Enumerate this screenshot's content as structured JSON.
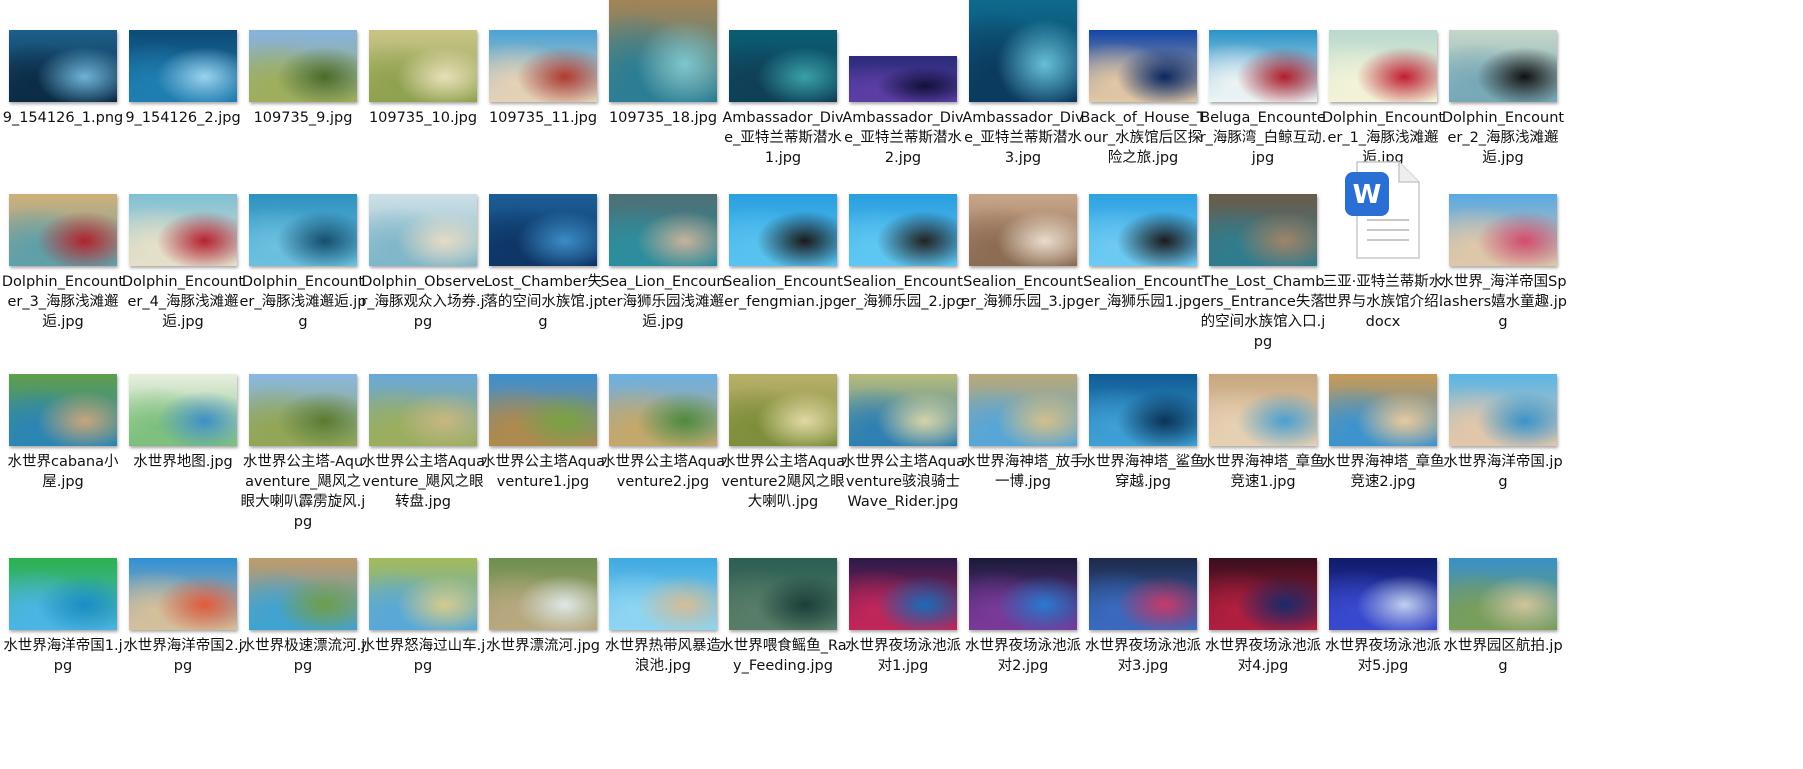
{
  "items": [
    {
      "name": "9_154126_1.png",
      "palette": [
        "#1d5f8a",
        "#0b2b45",
        "#6fb3d6"
      ],
      "shape": "wide"
    },
    {
      "name": "9_154126_2.jpg",
      "palette": [
        "#0d4a75",
        "#1f7fb2",
        "#9ad4f0"
      ],
      "shape": "wide"
    },
    {
      "name": "109735_9.jpg",
      "palette": [
        "#87b3df",
        "#9fae5b",
        "#4b6b2a"
      ],
      "shape": "wide"
    },
    {
      "name": "109735_10.jpg",
      "palette": [
        "#c9c587",
        "#8fa14f",
        "#e8e0b8"
      ],
      "shape": "wide"
    },
    {
      "name": "109735_11.jpg",
      "palette": [
        "#4aa3d6",
        "#e6d2b6",
        "#b23a2f"
      ],
      "shape": "wide"
    },
    {
      "name": "109735_18.jpg",
      "palette": [
        "#a98552",
        "#2a7e95",
        "#7ec7cf"
      ],
      "shape": "tall"
    },
    {
      "name": "Ambassador_Dive_亚特兰蒂斯潜水1.jpg",
      "palette": [
        "#0b5d73",
        "#0f3f57",
        "#3aa1a8"
      ],
      "shape": "wide"
    },
    {
      "name": "Ambassador_Dive_亚特兰蒂斯潜水2.jpg",
      "palette": [
        "#2b2b7a",
        "#5c3ea5",
        "#11113b"
      ],
      "shape": "small"
    },
    {
      "name": "Ambassador_Dive_亚特兰蒂斯潜水3.jpg",
      "palette": [
        "#0e6d8f",
        "#0b3a5e",
        "#68c0d8"
      ],
      "shape": "tall"
    },
    {
      "name": "Back_of_House_Tour_水族馆后区探险之旅.jpg",
      "palette": [
        "#1246a6",
        "#e3c8a4",
        "#0a2760"
      ],
      "shape": "wide"
    },
    {
      "name": "Beluga_Encounter_海豚湾_白鲸互动.jpg",
      "palette": [
        "#2a93c8",
        "#eef4f4",
        "#b21e2a"
      ],
      "shape": "wide"
    },
    {
      "name": "Dolphin_Encounter_1_海豚浅滩邂逅.jpg",
      "palette": [
        "#bad9cf",
        "#f3f3d7",
        "#c21e32"
      ],
      "shape": "wide"
    },
    {
      "name": "Dolphin_Encounter_2_海豚浅滩邂逅.jpg",
      "palette": [
        "#c6d7c9",
        "#77a8b7",
        "#111111"
      ],
      "shape": "wide"
    },
    {
      "name": "Dolphin_Encounter_3_海豚浅滩邂逅.jpg",
      "palette": [
        "#d1b07a",
        "#5e9fa9",
        "#b0232e"
      ],
      "shape": "wide"
    },
    {
      "name": "Dolphin_Encounter_4_海豚浅滩邂逅.jpg",
      "palette": [
        "#7fc0d5",
        "#e6e0c8",
        "#b8212f"
      ],
      "shape": "wide"
    },
    {
      "name": "Dolphin_Encounter_海豚浅滩邂逅.jpg",
      "palette": [
        "#2e92bf",
        "#6cc0e0",
        "#144f6e"
      ],
      "shape": "wide"
    },
    {
      "name": "Dolphin_Observer_海豚观众入场券.jpg",
      "palette": [
        "#cfe0e6",
        "#7fb6c9",
        "#e6dbc4"
      ],
      "shape": "wide"
    },
    {
      "name": "Lost_Chamber失落的空间水族馆.jpg",
      "palette": [
        "#1b5e96",
        "#0e3565",
        "#3c8cc6"
      ],
      "shape": "wide"
    },
    {
      "name": "Sea_Lion_Encounter海狮乐园浅滩邂逅.jpg",
      "palette": [
        "#4e6f75",
        "#2c8e9e",
        "#c7b39a"
      ],
      "shape": "wide"
    },
    {
      "name": "Sealion_Encounter_fengmian.jpg",
      "palette": [
        "#2b9fe0",
        "#58c3f0",
        "#1a1a1a"
      ],
      "shape": "wide"
    },
    {
      "name": "Sealion_Encounter_海狮乐园_2.jpg",
      "palette": [
        "#2a9ee0",
        "#5fc7f2",
        "#222222"
      ],
      "shape": "wide"
    },
    {
      "name": "Sealion_Encounter_海狮乐园_3.jpg",
      "palette": [
        "#c9a68a",
        "#8b6b52",
        "#e9dccc"
      ],
      "shape": "wide"
    },
    {
      "name": "Sealion_Encounter_海狮乐园1.jpg",
      "palette": [
        "#2ea2e2",
        "#6dcaf3",
        "#1b1b1b"
      ],
      "shape": "wide"
    },
    {
      "name": "The_Lost_Chambers_Entrance失落的空间水族馆入口.jpg",
      "palette": [
        "#6b5b4b",
        "#2f7d8f",
        "#a08468"
      ],
      "shape": "wide"
    },
    {
      "name": "三亚·亚特兰蒂斯水世界与水族馆介绍.docx",
      "palette": [
        "#2a6fd4",
        "#ffffff",
        "#cccccc"
      ],
      "shape": "doc"
    },
    {
      "name": "水世界_海洋帝国Splashers嬉水童趣.jpg",
      "palette": [
        "#5aa9e2",
        "#e0c8a8",
        "#d44b6a"
      ],
      "shape": "wide"
    },
    {
      "name": "水世界cabana小屋.jpg",
      "palette": [
        "#5e9e4e",
        "#2a85b5",
        "#c9a57c"
      ],
      "shape": "wide"
    },
    {
      "name": "水世界地图.jpg",
      "palette": [
        "#e8efe0",
        "#7cbf7b",
        "#3d8fc7"
      ],
      "shape": "wide"
    },
    {
      "name": "水世界公主塔-Aquaventure_飓风之眼大喇叭霹雳旋风.jpg",
      "palette": [
        "#8bb8e0",
        "#93a654",
        "#5b7a30"
      ],
      "shape": "wide"
    },
    {
      "name": "水世界公主塔Aquaventure_飓风之眼转盘.jpg",
      "palette": [
        "#6aa9d8",
        "#9cae5c",
        "#c9b77e"
      ],
      "shape": "wide"
    },
    {
      "name": "水世界公主塔Aquaventure1.jpg",
      "palette": [
        "#3c8fd2",
        "#b08a4c",
        "#79a33f"
      ],
      "shape": "wide"
    },
    {
      "name": "水世界公主塔Aquaventure2.jpg",
      "palette": [
        "#6db0e4",
        "#c5a86a",
        "#4d8a3c"
      ],
      "shape": "wide"
    },
    {
      "name": "水世界公主塔Aquaventure2飓风之眼大喇叭.jpg",
      "palette": [
        "#b9b06a",
        "#7d8e3a",
        "#e0d9a4"
      ],
      "shape": "wide"
    },
    {
      "name": "水世界公主塔Aquaventure骇浪骑士Wave_Rider.jpg",
      "palette": [
        "#b6bb7a",
        "#2c7fb3",
        "#d6d3a8"
      ],
      "shape": "wide"
    },
    {
      "name": "水世界海神塔_放手一博.jpg",
      "palette": [
        "#b8a97a",
        "#56a6d9",
        "#d3c08a"
      ],
      "shape": "wide"
    },
    {
      "name": "水世界海神塔_鲨鱼穿越.jpg",
      "palette": [
        "#0f5c95",
        "#3fa0d6",
        "#0a3459"
      ],
      "shape": "wide"
    },
    {
      "name": "水世界海神塔_章鱼竞速1.jpg",
      "palette": [
        "#c7a77e",
        "#e7d1b3",
        "#4aa0d0"
      ],
      "shape": "wide"
    },
    {
      "name": "水世界海神塔_章鱼竞速2.jpg",
      "palette": [
        "#c79a58",
        "#3b93cf",
        "#e9c99d"
      ],
      "shape": "wide"
    },
    {
      "name": "水世界海洋帝国.jpg",
      "palette": [
        "#5bb5e6",
        "#e4c7a9",
        "#3a93c9"
      ],
      "shape": "wide"
    },
    {
      "name": "水世界海洋帝国1.jpg",
      "palette": [
        "#2bb24c",
        "#4bb5e6",
        "#1b8cc7"
      ],
      "shape": "wide"
    },
    {
      "name": "水世界海洋帝国2.jpg",
      "palette": [
        "#2f8fd5",
        "#d7c09a",
        "#e35a3a"
      ],
      "shape": "wide"
    },
    {
      "name": "水世界极速漂流河.jpg",
      "palette": [
        "#c09b6a",
        "#3ea3d2",
        "#6d9e4a"
      ],
      "shape": "wide"
    },
    {
      "name": "水世界怒海过山车.jpg",
      "palette": [
        "#a4bb5b",
        "#57a8da",
        "#d4cc8e"
      ],
      "shape": "wide"
    },
    {
      "name": "水世界漂流河.jpg",
      "palette": [
        "#6e8f4e",
        "#b9a880",
        "#dfe8e6"
      ],
      "shape": "wide"
    },
    {
      "name": "水世界热带风暴造浪池.jpg",
      "palette": [
        "#3fa9e0",
        "#8fd6f2",
        "#d6bd96"
      ],
      "shape": "wide"
    },
    {
      "name": "水世界喂食鳐鱼_Ray_Feeding.jpg",
      "palette": [
        "#2c5e54",
        "#587d68",
        "#1b3f3a"
      ],
      "shape": "wide"
    },
    {
      "name": "水世界夜场泳池派对1.jpg",
      "palette": [
        "#2a1a4a",
        "#c2265a",
        "#1a6bb7"
      ],
      "shape": "wide"
    },
    {
      "name": "水世界夜场泳池派对2.jpg",
      "palette": [
        "#1a1a3a",
        "#7a3a9a",
        "#2a7ad0"
      ],
      "shape": "wide"
    },
    {
      "name": "水世界夜场泳池派对3.jpg",
      "palette": [
        "#1d2a4a",
        "#3a6ac0",
        "#c83a6a"
      ],
      "shape": "wide"
    },
    {
      "name": "水世界夜场泳池派对4.jpg",
      "palette": [
        "#3a0e1e",
        "#b21f3f",
        "#1b2a6a"
      ],
      "shape": "wide"
    },
    {
      "name": "水世界夜场泳池派对5.jpg",
      "palette": [
        "#0e1a6a",
        "#3a4ad0",
        "#c0d0f0"
      ],
      "shape": "wide"
    },
    {
      "name": "水世界园区航拍.jpg",
      "palette": [
        "#3a90c6",
        "#7a9e5a",
        "#d1c49a"
      ],
      "shape": "wide"
    }
  ],
  "doc_icon_letter": "W"
}
